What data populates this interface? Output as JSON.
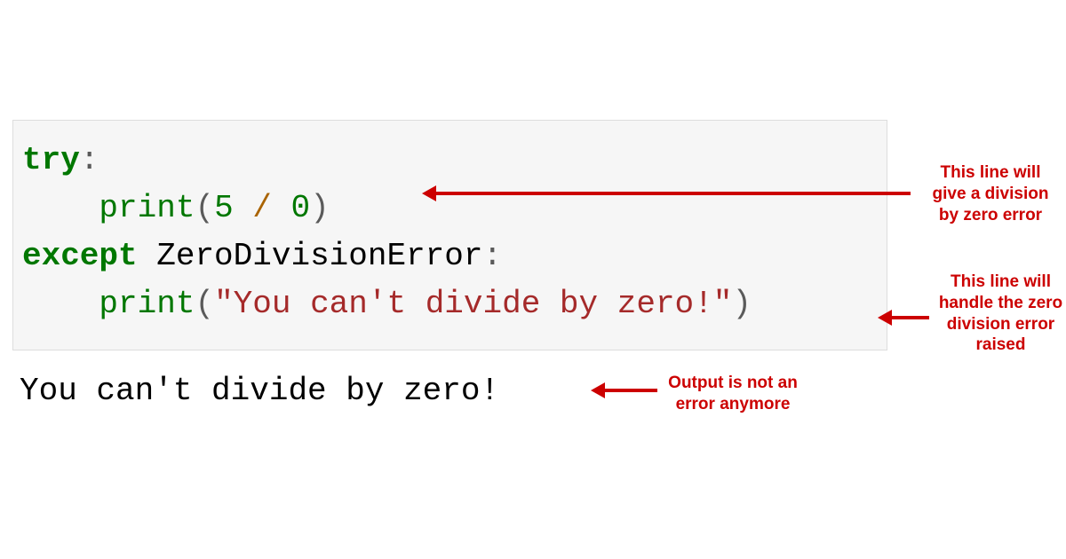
{
  "code": {
    "line1": {
      "try_kw": "try",
      "colon": ":"
    },
    "line2": {
      "indent": "    ",
      "print_fn": "print",
      "open_paren": "(",
      "arg1": "5",
      "space_op1": " ",
      "op": "/",
      "space_op2": " ",
      "arg2": "0",
      "close_paren": ")"
    },
    "line3": {
      "except_kw": "except",
      "space": " ",
      "exc_type": "ZeroDivisionError",
      "colon": ":"
    },
    "line4": {
      "indent": "    ",
      "print_fn": "print",
      "open_paren": "(",
      "str": "\"You can't divide by zero!\"",
      "close_paren": ")"
    }
  },
  "output": "You can't divide by zero!",
  "annotations": {
    "ann1": "This line will give a division by zero error",
    "ann2": "This line will handle the zero division error raised",
    "ann3": "Output is not an error anymore"
  },
  "colors": {
    "annotation": "#cc0000",
    "code_bg": "#f6f6f6",
    "keyword": "#007700",
    "string": "#a52a2a"
  }
}
